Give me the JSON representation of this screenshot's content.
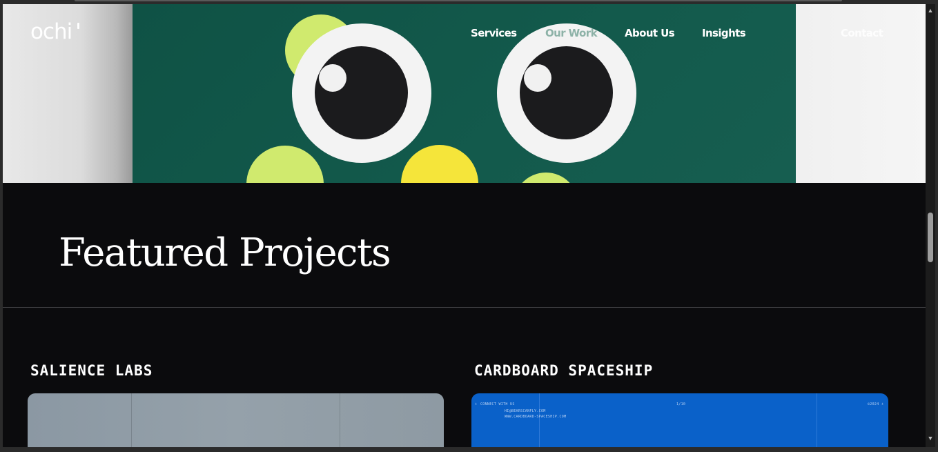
{
  "brand": {
    "logo_text": "ochi"
  },
  "nav": {
    "services": "Services",
    "our_work": "Our Work",
    "about_us": "About Us",
    "insights": "Insights",
    "contact": "Contact"
  },
  "featured": {
    "heading": "Featured Projects"
  },
  "projects": [
    {
      "title": "SALIENCE LABS"
    },
    {
      "title": "CARDBOARD SPACESHIP",
      "card_text": {
        "connect": "CONNECT WITH US",
        "email": "HI@BEARSCANFLY.COM",
        "website": "WWW.CARDBOARD-SPACESHIP.COM",
        "page": "1/10",
        "year": "©2024"
      }
    }
  ],
  "colors": {
    "hero_green": "#135a4c",
    "lime": "#d0ea6e",
    "yellow": "#f5e53a",
    "page_bg": "#0b0b0d",
    "cardboard_blue": "#0a61c9"
  },
  "icons": {
    "scroll_up": "triangle-up-icon",
    "scroll_down": "triangle-down-icon"
  }
}
